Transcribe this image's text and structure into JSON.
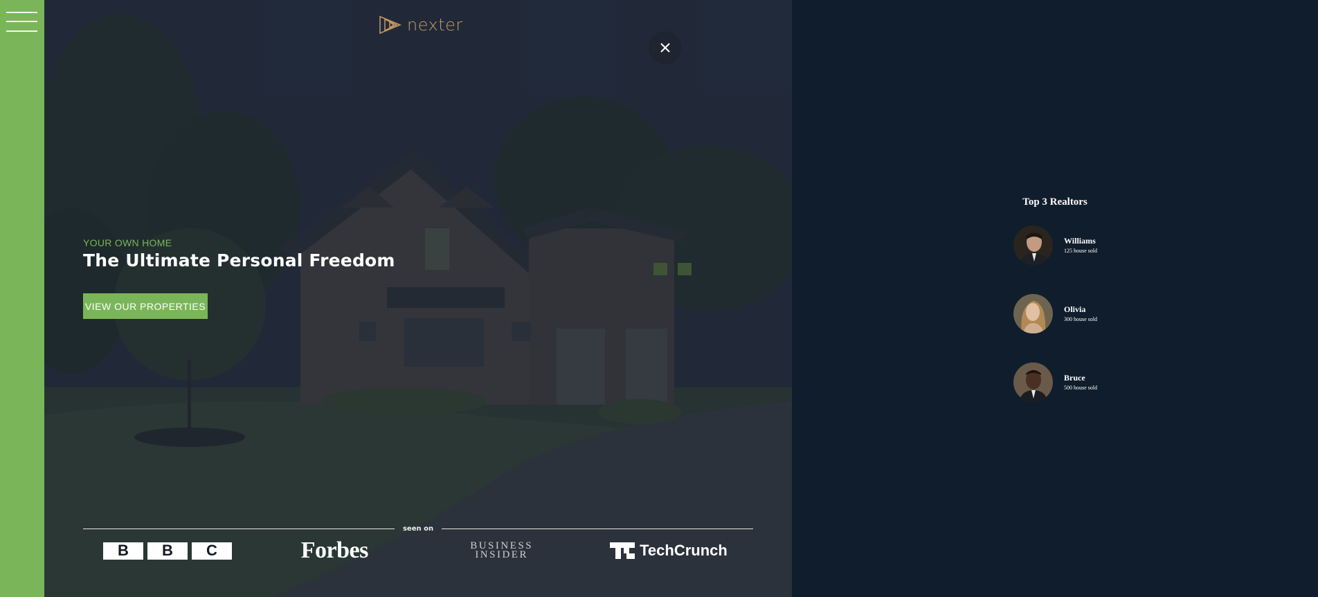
{
  "brand": {
    "name": "nexter",
    "accent": "#c69963"
  },
  "colors": {
    "green": "#7ab659",
    "navy": "#101d2c"
  },
  "sidebar": {
    "menu_icon": "hamburger-menu-icon"
  },
  "hero": {
    "subtitle": "YOUR OWN HOME",
    "title": "The Ultimate Personal Freedom",
    "button_label": "VIEW OUR PROPERTIES",
    "close_icon": "close-icon",
    "seen_on_label": "seen on",
    "brands": {
      "bbc": [
        "B",
        "B",
        "C"
      ],
      "forbes": "Forbes",
      "business_insider": [
        "BUSINESS",
        "INSIDER"
      ],
      "techcrunch": "TechCrunch"
    }
  },
  "realtors": {
    "title": "Top 3 Realtors",
    "items": [
      {
        "name": "Williams",
        "sold": "125 house sold"
      },
      {
        "name": "Olivia",
        "sold": "300 house sold"
      },
      {
        "name": "Bruce",
        "sold": "500 house sold"
      }
    ]
  }
}
